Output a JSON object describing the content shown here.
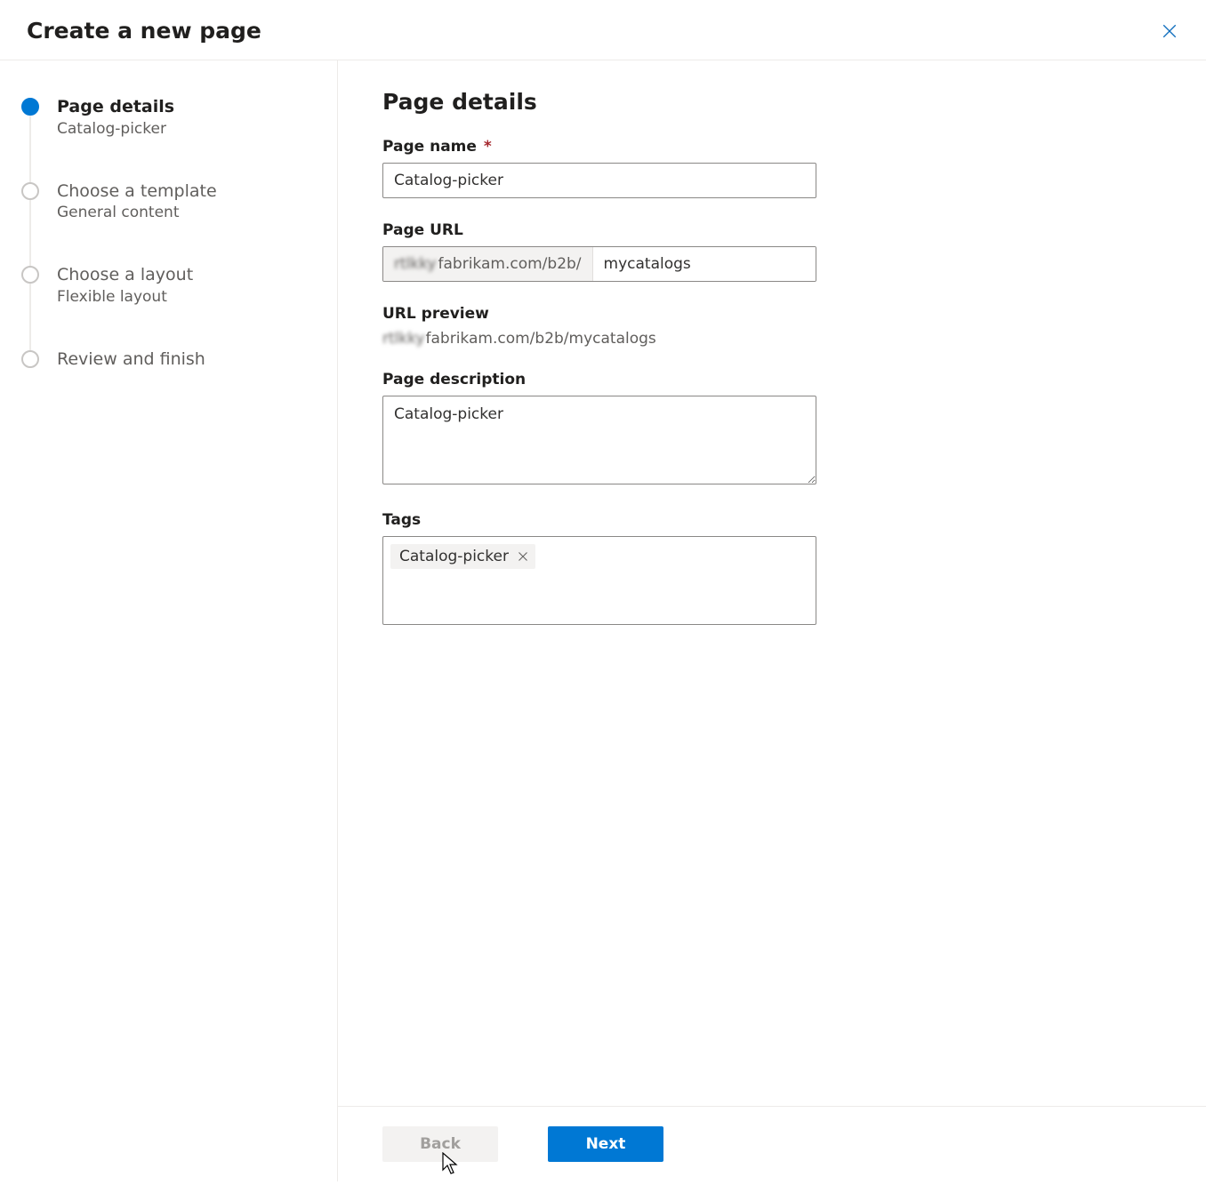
{
  "header": {
    "title": "Create a new page"
  },
  "steps": [
    {
      "title": "Page details",
      "sub": "Catalog-picker",
      "active": true
    },
    {
      "title": "Choose a template",
      "sub": "General content",
      "active": false
    },
    {
      "title": "Choose a layout",
      "sub": "Flexible layout",
      "active": false
    },
    {
      "title": "Review and finish",
      "sub": "",
      "active": false
    }
  ],
  "main": {
    "heading": "Page details",
    "pageName": {
      "label": "Page name",
      "required": "*",
      "value": "Catalog-picker"
    },
    "pageUrl": {
      "label": "Page URL",
      "prefixBlur": "rtlkky",
      "prefixClear": "fabrikam.com/b2b/",
      "value": "mycatalogs"
    },
    "urlPreview": {
      "label": "URL preview",
      "blur": "rtlkky",
      "clear": "fabrikam.com/b2b/mycatalogs"
    },
    "description": {
      "label": "Page description",
      "value": "Catalog-picker"
    },
    "tags": {
      "label": "Tags",
      "items": [
        "Catalog-picker"
      ]
    }
  },
  "footer": {
    "back": "Back",
    "next": "Next"
  }
}
